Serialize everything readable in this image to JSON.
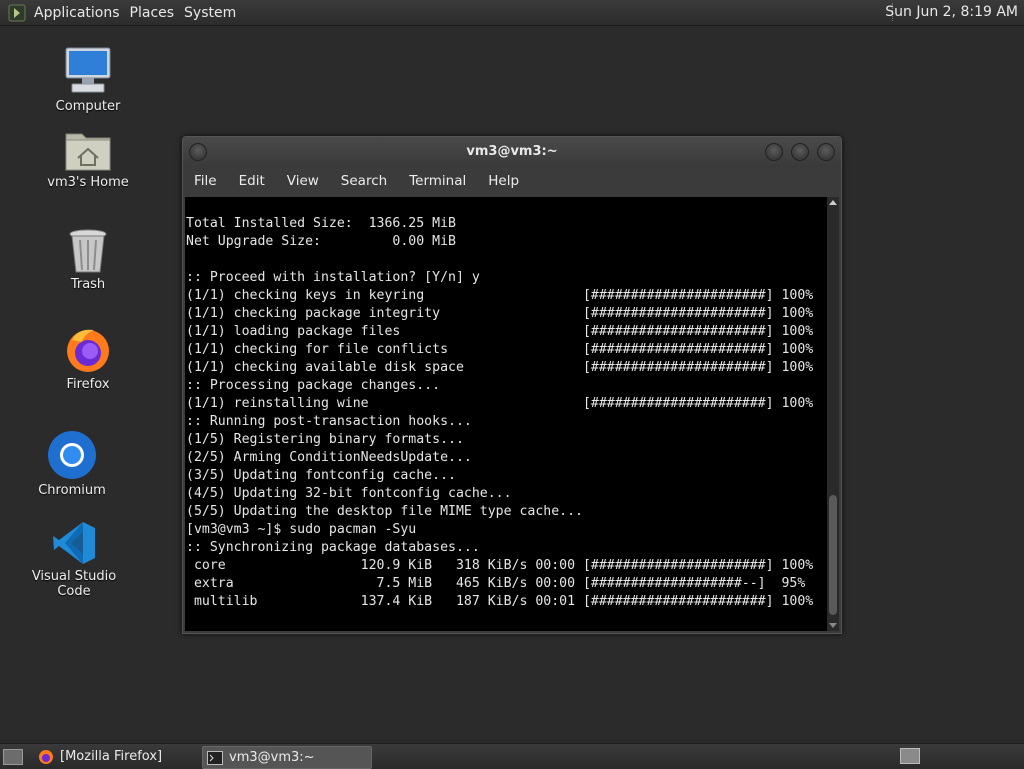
{
  "top_panel": {
    "menus": [
      "Applications",
      "Places",
      "System"
    ],
    "clock": "Sun Jun  2,  8:19 AM"
  },
  "desktop_icons": [
    {
      "label": "Computer",
      "icon": "computer-icon"
    },
    {
      "label": "vm3's Home",
      "icon": "home-folder-icon"
    },
    {
      "label": "Trash",
      "icon": "trash-icon"
    },
    {
      "label": "Firefox",
      "icon": "firefox-icon"
    },
    {
      "label": "Chromium",
      "icon": "chromium-icon"
    },
    {
      "label": "Visual Studio Code",
      "icon": "vscode-icon"
    }
  ],
  "terminal": {
    "title": "vm3@vm3:~",
    "menus": [
      "File",
      "Edit",
      "View",
      "Search",
      "Terminal",
      "Help"
    ],
    "lines": [
      "Total Installed Size:  1366.25 MiB",
      "Net Upgrade Size:         0.00 MiB",
      "",
      ":: Proceed with installation? [Y/n] y",
      "(1/1) checking keys in keyring                    [######################] 100%",
      "(1/1) checking package integrity                  [######################] 100%",
      "(1/1) loading package files                       [######################] 100%",
      "(1/1) checking for file conflicts                 [######################] 100%",
      "(1/1) checking available disk space               [######################] 100%",
      ":: Processing package changes...",
      "(1/1) reinstalling wine                           [######################] 100%",
      ":: Running post-transaction hooks...",
      "(1/5) Registering binary formats...",
      "(2/5) Arming ConditionNeedsUpdate...",
      "(3/5) Updating fontconfig cache...",
      "(4/5) Updating 32-bit fontconfig cache...",
      "(5/5) Updating the desktop file MIME type cache...",
      "[vm3@vm3 ~]$ sudo pacman -Syu",
      ":: Synchronizing package databases...",
      " core                 120.9 KiB   318 KiB/s 00:00 [######################] 100%",
      " extra                  7.5 MiB   465 KiB/s 00:00 [###################--]  95%",
      " multilib             137.4 KiB   187 KiB/s 00:01 [######################] 100%"
    ]
  },
  "taskbar": {
    "tasks": [
      {
        "label": "[Mozilla Firefox]",
        "icon": "firefox-icon"
      },
      {
        "label": "vm3@vm3:~",
        "icon": "terminal-icon"
      }
    ]
  }
}
